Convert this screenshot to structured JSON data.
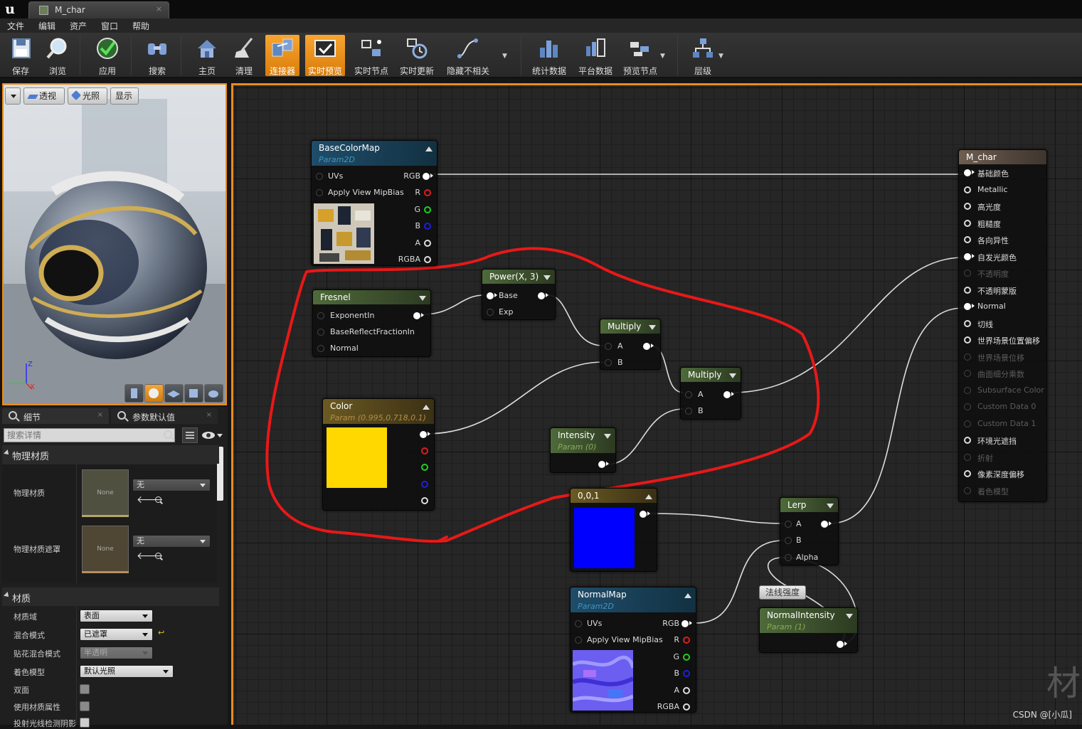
{
  "window": {
    "tab_title": "M_char",
    "tab_close": "×"
  },
  "menu": [
    "文件",
    "编辑",
    "资产",
    "窗口",
    "帮助"
  ],
  "toolbar": [
    {
      "label": "保存",
      "icon": "save-icon"
    },
    {
      "label": "浏览",
      "icon": "browse-icon"
    },
    {
      "label": "应用",
      "icon": "apply-icon"
    },
    {
      "label": "搜索",
      "icon": "search-icon"
    },
    {
      "label": "主页",
      "icon": "home-icon"
    },
    {
      "label": "清理",
      "icon": "clean-icon"
    },
    {
      "label": "连接器",
      "icon": "connectors-icon",
      "active": true
    },
    {
      "label": "实时预览",
      "icon": "live-preview-icon",
      "active": true
    },
    {
      "label": "实时节点",
      "icon": "live-nodes-icon"
    },
    {
      "label": "实时更新",
      "icon": "live-update-icon"
    },
    {
      "label": "隐藏不相关",
      "icon": "hide-unrelated-icon"
    },
    {
      "label": "统计数据",
      "icon": "stats-icon"
    },
    {
      "label": "平台数据",
      "icon": "platform-stats-icon"
    },
    {
      "label": "预览节点",
      "icon": "preview-node-icon"
    },
    {
      "label": "层级",
      "icon": "hierarchy-icon"
    }
  ],
  "viewport": {
    "buttons": [
      "透视",
      "光照",
      "显示"
    ],
    "axis_z": "Z",
    "axis_x": "X"
  },
  "details": {
    "tab_details": "细节",
    "tab_params": "参数默认值",
    "search_placeholder": "搜索详情",
    "section_physical": "物理材质",
    "phys_mat_label": "物理材质",
    "phys_mat_value": "无",
    "phys_mat_thumb": "None",
    "phys_mask_label": "物理材质遮罩",
    "phys_mask_value": "无",
    "phys_mask_thumb": "None",
    "section_material": "材质",
    "domain_label": "材质域",
    "domain_value": "表面",
    "blend_label": "混合模式",
    "blend_value": "已遮罩",
    "decal_label": "贴花混合模式",
    "decal_value": "半透明",
    "shading_label": "着色模型",
    "shading_value": "默认光照",
    "two_sided_label": "双面",
    "use_attr_label": "使用材质属性",
    "ray_label": "投射光线检测阴影"
  },
  "graph": {
    "basecolormap": {
      "title": "BaseColorMap",
      "subtitle": "Param2D",
      "inputs": [
        "UVs",
        "Apply View MipBias"
      ],
      "outputs": [
        "RGB",
        "R",
        "G",
        "B",
        "A",
        "RGBA"
      ]
    },
    "fresnel": {
      "title": "Fresnel",
      "inputs": [
        "ExponentIn",
        "BaseReflectFractionIn",
        "Normal"
      ]
    },
    "power": {
      "title": "Power(X, 3)",
      "inputs": [
        "Base",
        "Exp"
      ]
    },
    "multiply1": {
      "title": "Multiply",
      "inputs": [
        "A",
        "B"
      ]
    },
    "multiply2": {
      "title": "Multiply",
      "inputs": [
        "A",
        "B"
      ]
    },
    "color": {
      "title": "Color",
      "subtitle": "Param (0.995,0.718,0.1)",
      "swatch": "#ffd800"
    },
    "intensity": {
      "title": "Intensity",
      "subtitle": "Param (0)"
    },
    "const001": {
      "title": "0,0,1",
      "swatch": "#0000ff"
    },
    "lerp": {
      "title": "Lerp",
      "inputs": [
        "A",
        "B",
        "Alpha"
      ]
    },
    "normalmap": {
      "title": "NormalMap",
      "subtitle": "Param2D",
      "inputs": [
        "UVs",
        "Apply View MipBias"
      ],
      "outputs": [
        "RGB",
        "R",
        "G",
        "B",
        "A",
        "RGBA"
      ]
    },
    "comment": "法线强度",
    "normalintensity": {
      "title": "NormalIntensity",
      "subtitle": "Param (1)"
    },
    "result": {
      "title": "M_char",
      "pins": [
        {
          "label": "基础颜色",
          "active": true,
          "connected": true
        },
        {
          "label": "Metallic",
          "active": true
        },
        {
          "label": "高光度",
          "active": true
        },
        {
          "label": "粗糙度",
          "active": true
        },
        {
          "label": "各向异性",
          "active": true
        },
        {
          "label": "自发光颜色",
          "active": true,
          "connected": true
        },
        {
          "label": "不透明度",
          "active": false
        },
        {
          "label": "不透明蒙版",
          "active": true
        },
        {
          "label": "Normal",
          "active": true,
          "connected": true
        },
        {
          "label": "切线",
          "active": true
        },
        {
          "label": "世界场景位置偏移",
          "active": true
        },
        {
          "label": "世界场景位移",
          "active": false
        },
        {
          "label": "曲面细分乘数",
          "active": false
        },
        {
          "label": "Subsurface Color",
          "active": false
        },
        {
          "label": "Custom Data 0",
          "active": false
        },
        {
          "label": "Custom Data 1",
          "active": false
        },
        {
          "label": "环境光遮挡",
          "active": true
        },
        {
          "label": "折射",
          "active": false
        },
        {
          "label": "像素深度偏移",
          "active": true
        },
        {
          "label": "着色模型",
          "active": false
        }
      ]
    },
    "annotation_color": "#e81818"
  },
  "watermark": "CSDN @[小瓜]",
  "watermark_glyph": "材"
}
